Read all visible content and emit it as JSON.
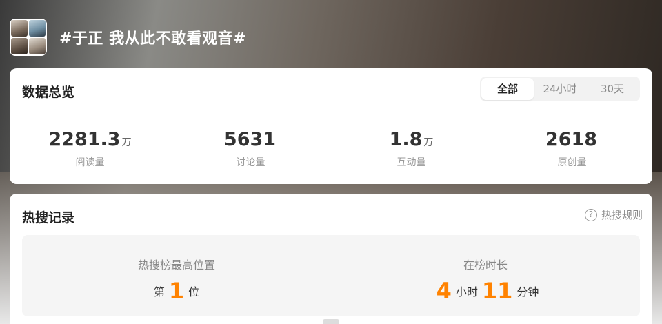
{
  "topic": {
    "title": "#于正 我从此不敢看观音#"
  },
  "overview": {
    "title": "数据总览",
    "tabs": [
      {
        "label": "全部",
        "active": true
      },
      {
        "label": "24小时",
        "active": false
      },
      {
        "label": "30天",
        "active": false
      }
    ],
    "stats": [
      {
        "value": "2281.3",
        "unit": "万",
        "label": "阅读量"
      },
      {
        "value": "5631",
        "unit": "",
        "label": "讨论量"
      },
      {
        "value": "1.8",
        "unit": "万",
        "label": "互动量"
      },
      {
        "value": "2618",
        "unit": "",
        "label": "原创量"
      }
    ]
  },
  "hot_search": {
    "title": "热搜记录",
    "rules_label": "热搜规则",
    "help_glyph": "?",
    "highest_position": {
      "label": "热搜榜最高位置",
      "prefix": "第",
      "value": "1",
      "suffix": "位"
    },
    "duration": {
      "label": "在榜时长",
      "hours": "4",
      "hours_unit": "小时",
      "minutes": "11",
      "minutes_unit": "分钟"
    }
  },
  "colors": {
    "accent": "#ff8200",
    "card_bg": "#ffffff",
    "panel_bg": "#f5f5f5"
  }
}
